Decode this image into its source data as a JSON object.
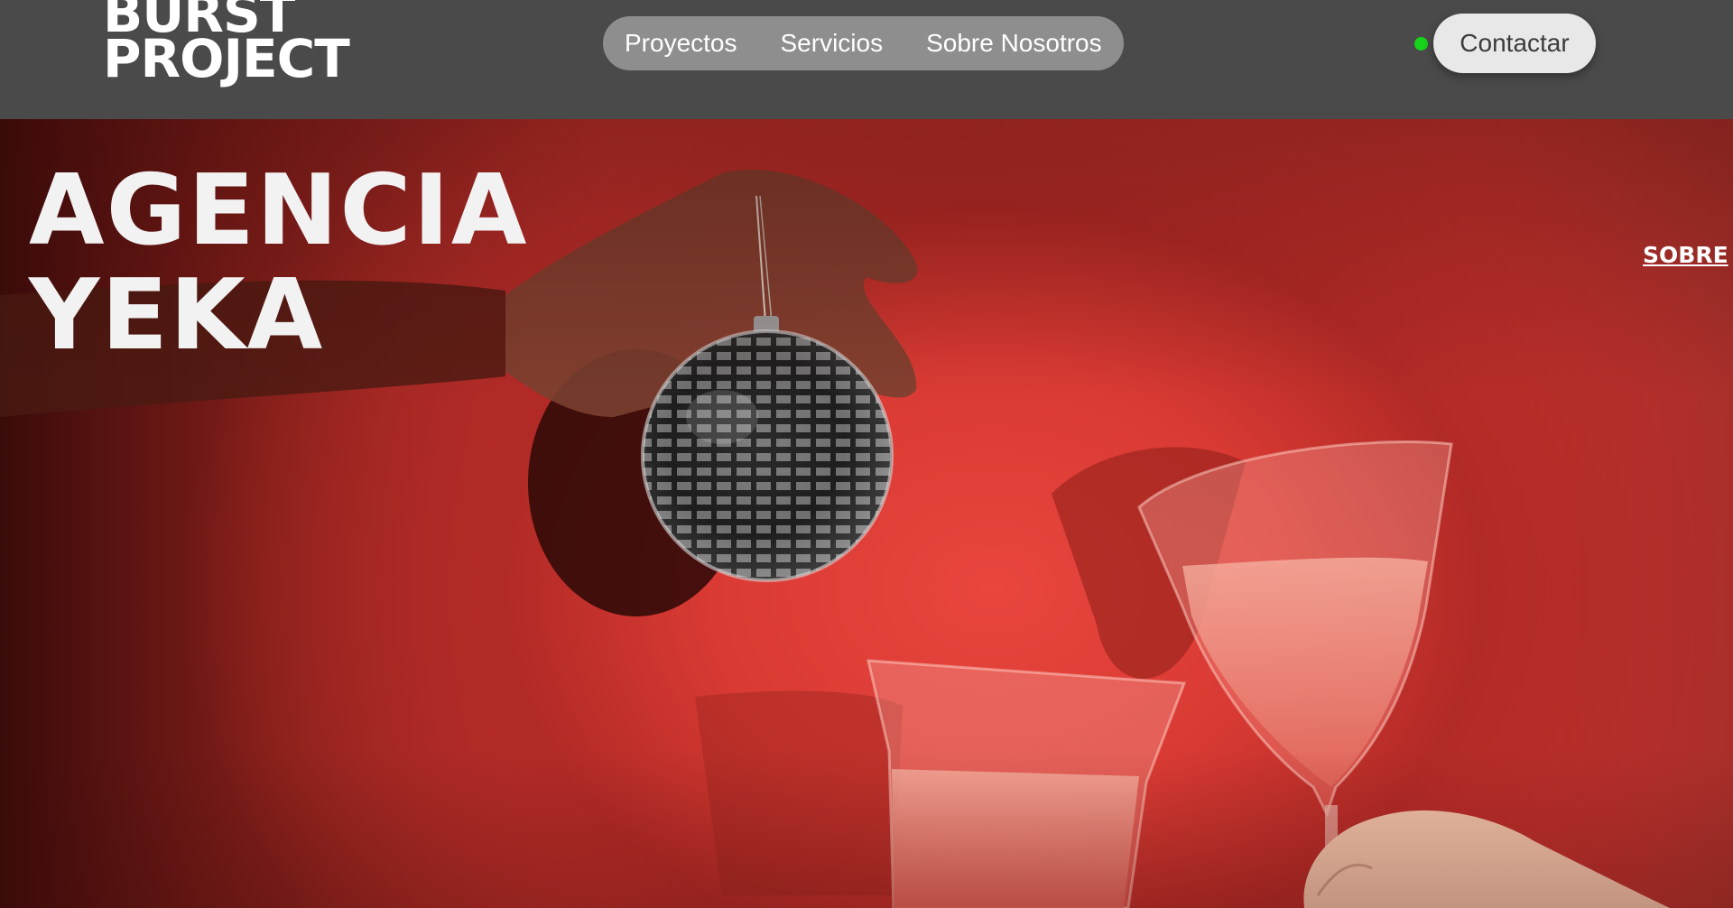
{
  "header": {
    "logo_line1": "BURST",
    "logo_line2": "PROJECT",
    "nav": [
      "Proyectos",
      "Servicios",
      "Sobre Nosotros"
    ],
    "contact_label": "Contactar",
    "status_color": "#16d21a"
  },
  "hero": {
    "title_line1": "AGENCIA",
    "title_line2": "YEKA",
    "side_link": "SOBRE",
    "background_color": "#d63c36",
    "image_subjects": [
      "hand-holding-disco-ball",
      "disco-ball",
      "champagne-glass-left",
      "champagne-glass-right",
      "hand-holding-glass"
    ]
  }
}
